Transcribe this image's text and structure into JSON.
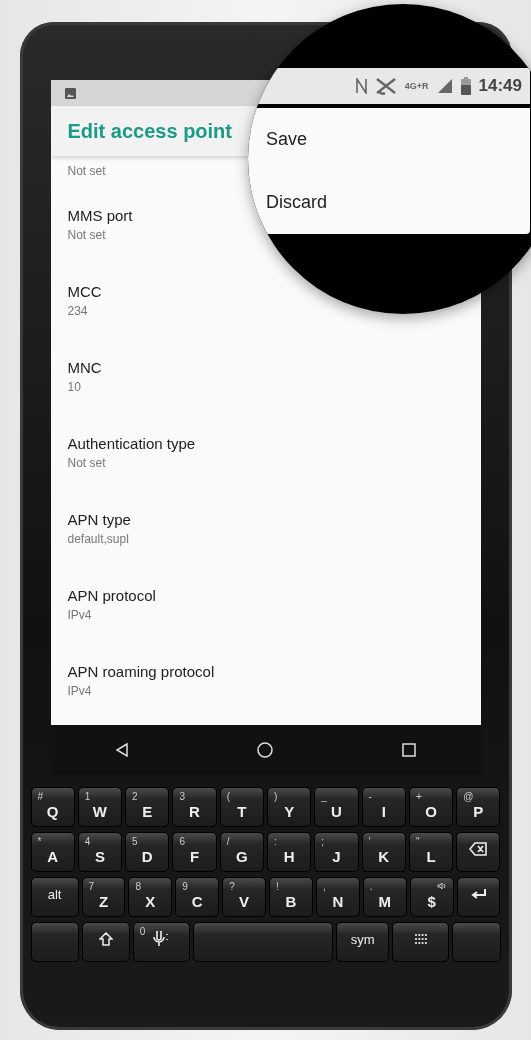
{
  "screen_status_bar": {
    "kind": "notification"
  },
  "app_bar": {
    "title": "Edit access point"
  },
  "settings": [
    {
      "summary": "Not set"
    },
    {
      "title": "MMS port",
      "summary": "Not set"
    },
    {
      "title": "MCC",
      "summary": "234"
    },
    {
      "title": "MNC",
      "summary": "10"
    },
    {
      "title": "Authentication type",
      "summary": "Not set"
    },
    {
      "title": "APN type",
      "summary": "default,supl"
    },
    {
      "title": "APN protocol",
      "summary": "IPv4"
    },
    {
      "title": "APN roaming protocol",
      "summary": "IPv4"
    }
  ],
  "nav_bar": [
    {
      "kind": "back"
    },
    {
      "kind": "home"
    },
    {
      "kind": "recents"
    }
  ],
  "magnifier": {
    "status_bar": {
      "network": "4G+R",
      "time": "14:49"
    },
    "menu": [
      {
        "label": "Save"
      },
      {
        "label": "Discard"
      }
    ]
  },
  "keyboard": [
    [
      {
        "kind": "char",
        "label": "Q",
        "alt": "#"
      },
      {
        "kind": "char",
        "label": "W",
        "alt": "1"
      },
      {
        "kind": "char",
        "label": "E",
        "alt": "2"
      },
      {
        "kind": "char",
        "label": "R",
        "alt": "3"
      },
      {
        "kind": "char",
        "label": "T",
        "alt": "("
      },
      {
        "kind": "char",
        "label": "Y",
        "alt": ")"
      },
      {
        "kind": "char",
        "label": "U",
        "alt": "_"
      },
      {
        "kind": "char",
        "label": "I",
        "alt": "-"
      },
      {
        "kind": "char",
        "label": "O",
        "alt": "+"
      },
      {
        "kind": "char",
        "label": "P",
        "alt": "@"
      }
    ],
    [
      {
        "kind": "char",
        "label": "A",
        "alt": "*"
      },
      {
        "kind": "char",
        "label": "S",
        "alt": "4"
      },
      {
        "kind": "char",
        "label": "D",
        "alt": "5"
      },
      {
        "kind": "char",
        "label": "F",
        "alt": "6"
      },
      {
        "kind": "char",
        "label": "G",
        "alt": "/"
      },
      {
        "kind": "char",
        "label": "H",
        "alt": ":"
      },
      {
        "kind": "char",
        "label": "J",
        "alt": ";"
      },
      {
        "kind": "char",
        "label": "K",
        "alt": "'"
      },
      {
        "kind": "char",
        "label": "L",
        "alt": "\""
      },
      {
        "kind": "backspace"
      }
    ],
    [
      {
        "kind": "word",
        "label": "alt"
      },
      {
        "kind": "char",
        "label": "Z",
        "alt": "7"
      },
      {
        "kind": "char",
        "label": "X",
        "alt": "8"
      },
      {
        "kind": "char",
        "label": "C",
        "alt": "9"
      },
      {
        "kind": "char",
        "label": "V",
        "alt": "?"
      },
      {
        "kind": "char",
        "label": "B",
        "alt": "!"
      },
      {
        "kind": "char",
        "label": "N",
        "alt": ","
      },
      {
        "kind": "char",
        "label": "M",
        "alt": "."
      },
      {
        "kind": "speaker-char",
        "label": "$"
      },
      {
        "kind": "enter"
      }
    ],
    [
      {
        "kind": "blank"
      },
      {
        "kind": "shift"
      },
      {
        "kind": "mic",
        "alt": "0"
      },
      {
        "kind": "space"
      },
      {
        "kind": "word",
        "label": "sym"
      },
      {
        "kind": "grid"
      },
      {
        "kind": "blank"
      }
    ]
  ]
}
